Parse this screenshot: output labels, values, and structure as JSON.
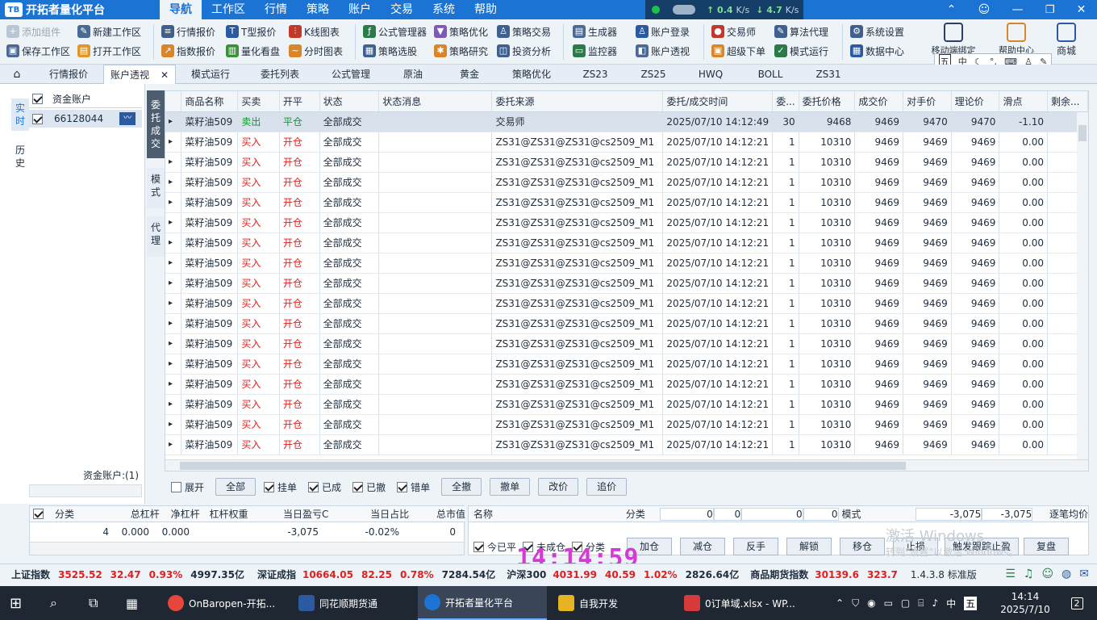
{
  "app": {
    "title": "开拓者量化平台",
    "logo": "TB"
  },
  "menu": [
    "导航",
    "工作区",
    "行情",
    "策略",
    "账户",
    "交易",
    "系统",
    "帮助"
  ],
  "ticker": {
    "up": "↑ 0.4",
    "up_unit": "K/s",
    "down": "↓ 4.7",
    "down_unit": "K/s"
  },
  "toolbar": {
    "col1": [
      "添加组件",
      "保存工作区"
    ],
    "col2": [
      "新建工作区",
      "打开工作区"
    ],
    "col3": [
      "行情报价",
      "指数报价"
    ],
    "col4": [
      "T型报价",
      "量化看盘"
    ],
    "col5": [
      "K线图表",
      "分时图表"
    ],
    "col6": [
      "公式管理器",
      "策略选股"
    ],
    "col7": [
      "策略优化",
      "策略研究"
    ],
    "col8": [
      "策略交易",
      "投资分析"
    ],
    "col9": [
      "生成器",
      "监控器"
    ],
    "col10": [
      "账户登录",
      "账户透视"
    ],
    "col11": [
      "交易师",
      "超级下单"
    ],
    "col12": [
      "算法代理",
      "模式运行"
    ],
    "col13": [
      "系统设置",
      "数据中心"
    ],
    "big": [
      "移动端绑定",
      "帮助中心",
      "商城"
    ]
  },
  "tabs": [
    "行情报价",
    "账户透视",
    "模式运行",
    "委托列表",
    "公式管理",
    "原油",
    "黄金",
    "策略优化",
    "ZS23",
    "ZS25",
    "HWQ",
    "BOLL",
    "ZS31"
  ],
  "left": {
    "vtabs": [
      "实时",
      "历史"
    ],
    "header": "资金账户",
    "account": "66128044",
    "footer": "资金账户:(1)"
  },
  "subtabs": [
    "委托成交",
    "模式",
    "代理"
  ],
  "columns": [
    "商品名称",
    "买卖",
    "开平",
    "状态",
    "状态消息",
    "委托来源",
    "委托/成交时间",
    "委...",
    "委托价格",
    "成交价",
    "对手价",
    "理论价",
    "滑点",
    "剩余..."
  ],
  "rows": [
    [
      "菜籽油509",
      "卖出",
      "平仓",
      "全部成交",
      "",
      "交易师",
      "2025/07/10 14:12:49",
      "30",
      "9468",
      "9469",
      "9470",
      "9470",
      "-1.10",
      ""
    ],
    [
      "菜籽油509",
      "买入",
      "开仓",
      "全部成交",
      "",
      "ZS31@ZS31@ZS31@cs2509_M1",
      "2025/07/10 14:12:21",
      "1",
      "10310",
      "9469",
      "9469",
      "9469",
      "0.00",
      ""
    ],
    [
      "菜籽油509",
      "买入",
      "开仓",
      "全部成交",
      "",
      "ZS31@ZS31@ZS31@cs2509_M1",
      "2025/07/10 14:12:21",
      "1",
      "10310",
      "9469",
      "9469",
      "9469",
      "0.00",
      ""
    ],
    [
      "菜籽油509",
      "买入",
      "开仓",
      "全部成交",
      "",
      "ZS31@ZS31@ZS31@cs2509_M1",
      "2025/07/10 14:12:21",
      "1",
      "10310",
      "9469",
      "9469",
      "9469",
      "0.00",
      ""
    ],
    [
      "菜籽油509",
      "买入",
      "开仓",
      "全部成交",
      "",
      "ZS31@ZS31@ZS31@cs2509_M1",
      "2025/07/10 14:12:21",
      "1",
      "10310",
      "9469",
      "9469",
      "9469",
      "0.00",
      ""
    ],
    [
      "菜籽油509",
      "买入",
      "开仓",
      "全部成交",
      "",
      "ZS31@ZS31@ZS31@cs2509_M1",
      "2025/07/10 14:12:21",
      "1",
      "10310",
      "9469",
      "9469",
      "9469",
      "0.00",
      ""
    ],
    [
      "菜籽油509",
      "买入",
      "开仓",
      "全部成交",
      "",
      "ZS31@ZS31@ZS31@cs2509_M1",
      "2025/07/10 14:12:21",
      "1",
      "10310",
      "9469",
      "9469",
      "9469",
      "0.00",
      ""
    ],
    [
      "菜籽油509",
      "买入",
      "开仓",
      "全部成交",
      "",
      "ZS31@ZS31@ZS31@cs2509_M1",
      "2025/07/10 14:12:21",
      "1",
      "10310",
      "9469",
      "9469",
      "9469",
      "0.00",
      ""
    ],
    [
      "菜籽油509",
      "买入",
      "开仓",
      "全部成交",
      "",
      "ZS31@ZS31@ZS31@cs2509_M1",
      "2025/07/10 14:12:21",
      "1",
      "10310",
      "9469",
      "9469",
      "9469",
      "0.00",
      ""
    ],
    [
      "菜籽油509",
      "买入",
      "开仓",
      "全部成交",
      "",
      "ZS31@ZS31@ZS31@cs2509_M1",
      "2025/07/10 14:12:21",
      "1",
      "10310",
      "9469",
      "9469",
      "9469",
      "0.00",
      ""
    ],
    [
      "菜籽油509",
      "买入",
      "开仓",
      "全部成交",
      "",
      "ZS31@ZS31@ZS31@cs2509_M1",
      "2025/07/10 14:12:21",
      "1",
      "10310",
      "9469",
      "9469",
      "9469",
      "0.00",
      ""
    ],
    [
      "菜籽油509",
      "买入",
      "开仓",
      "全部成交",
      "",
      "ZS31@ZS31@ZS31@cs2509_M1",
      "2025/07/10 14:12:21",
      "1",
      "10310",
      "9469",
      "9469",
      "9469",
      "0.00",
      ""
    ],
    [
      "菜籽油509",
      "买入",
      "开仓",
      "全部成交",
      "",
      "ZS31@ZS31@ZS31@cs2509_M1",
      "2025/07/10 14:12:21",
      "1",
      "10310",
      "9469",
      "9469",
      "9469",
      "0.00",
      ""
    ],
    [
      "菜籽油509",
      "买入",
      "开仓",
      "全部成交",
      "",
      "ZS31@ZS31@ZS31@cs2509_M1",
      "2025/07/10 14:12:21",
      "1",
      "10310",
      "9469",
      "9469",
      "9469",
      "0.00",
      ""
    ],
    [
      "菜籽油509",
      "买入",
      "开仓",
      "全部成交",
      "",
      "ZS31@ZS31@ZS31@cs2509_M1",
      "2025/07/10 14:12:21",
      "1",
      "10310",
      "9469",
      "9469",
      "9469",
      "0.00",
      ""
    ],
    [
      "菜籽油509",
      "买入",
      "开仓",
      "全部成交",
      "",
      "ZS31@ZS31@ZS31@cs2509_M1",
      "2025/07/10 14:12:21",
      "1",
      "10310",
      "9469",
      "9469",
      "9469",
      "0.00",
      ""
    ],
    [
      "菜籽油509",
      "买入",
      "开仓",
      "全部成交",
      "",
      "ZS31@ZS31@ZS31@cs2509_M1",
      "2025/07/10 14:12:21",
      "1",
      "10310",
      "9469",
      "9469",
      "9469",
      "0.00",
      ""
    ]
  ],
  "filters": {
    "expand": "展开",
    "all": "全部",
    "pending": "挂单",
    "filled": "已成",
    "cancelled": "已撤",
    "error": "错单",
    "cancel_all": "全撤",
    "cancel": "撤单",
    "modify": "改价",
    "chase": "追价"
  },
  "summary": {
    "columns": [
      "分类",
      "总杠杆",
      "净杠杆",
      "杠杆权重",
      "当日盈亏C",
      "当日占比",
      "总市值"
    ],
    "row": [
      "4",
      "0.000",
      "0.000",
      "",
      "-3,075",
      "-0.02%",
      "0"
    ]
  },
  "positions": {
    "header": [
      "名称",
      "分类",
      "0",
      "0",
      "0",
      "0",
      "模式",
      "-3,075",
      "-3,075",
      "逐笔均价"
    ],
    "checks": [
      "今已平",
      "未成仓",
      "分类"
    ],
    "buttons": [
      "加仓",
      "减仓",
      "反手",
      "解锁",
      "移仓",
      "止损",
      "触发跟踪止盈",
      "复盘"
    ]
  },
  "clock": "14:14:59",
  "watermark": {
    "line1": "激活 Windows",
    "line2": "转到\"设置\"以激活 Windows。"
  },
  "status": {
    "sh_label": "上证指数",
    "sh_val": "3525.52",
    "sh_chg": "32.47",
    "sh_pct": "0.93%",
    "sh_amt": "4997.35亿",
    "sz_label": "深证成指",
    "sz_val": "10664.05",
    "sz_chg": "82.25",
    "sz_pct": "0.78%",
    "sz_amt": "7284.54亿",
    "hs_label": "沪深300",
    "hs_val": "4031.99",
    "hs_chg": "40.59",
    "hs_pct": "1.02%",
    "hs_amt": "2826.64亿",
    "fut_label": "商品期货指数",
    "fut_val": "30139.6",
    "fut_chg": "323.7",
    "version": "1.4.3.8 标准版"
  },
  "taskbar": {
    "items": [
      "OnBaropen-开拓...",
      "同花顺期货通",
      "开拓者量化平台",
      "自我开发",
      "0订单域.xlsx - WP..."
    ],
    "time": "14:14",
    "date": "2025/7/10",
    "lang": "中",
    "notify": "2"
  },
  "colors": {
    "accent": "#1b74d4",
    "buy": "#e02020",
    "sell": "#0a9a2a"
  }
}
